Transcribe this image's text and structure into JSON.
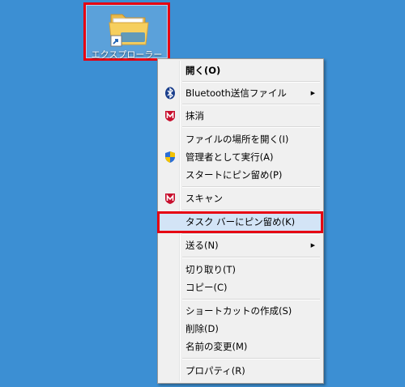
{
  "desktop": {
    "icon_label": "エクスプローラー",
    "icon_name": "folder-shortcut-icon"
  },
  "menu": {
    "items": [
      {
        "label": "開く(O)",
        "icon": null,
        "bold": true
      },
      {
        "label": "Bluetooth送信ファイル",
        "icon": "bluetooth-icon",
        "submenu": true
      },
      {
        "label": "抹消",
        "icon": "mcafee-icon"
      },
      {
        "label": "ファイルの場所を開く(I)",
        "icon": null
      },
      {
        "label": "管理者として実行(A)",
        "icon": "uac-shield-icon"
      },
      {
        "label": "スタートにピン留め(P)",
        "icon": null
      },
      {
        "label": "スキャン",
        "icon": "mcafee-icon"
      },
      {
        "label": "タスク バーにピン留め(K)",
        "icon": null,
        "highlighted": true
      },
      {
        "label": "送る(N)",
        "icon": null,
        "submenu": true
      },
      {
        "label": "切り取り(T)",
        "icon": null
      },
      {
        "label": "コピー(C)",
        "icon": null
      },
      {
        "label": "ショートカットの作成(S)",
        "icon": null
      },
      {
        "label": "削除(D)",
        "icon": null
      },
      {
        "label": "名前の変更(M)",
        "icon": null
      },
      {
        "label": "プロパティ(R)",
        "icon": null
      }
    ],
    "submenu_arrow": "▶"
  },
  "colors": {
    "desktop_bg": "#3c8fd3",
    "highlight_border": "#e60012",
    "highlight_fill": "#d3e4f6"
  }
}
